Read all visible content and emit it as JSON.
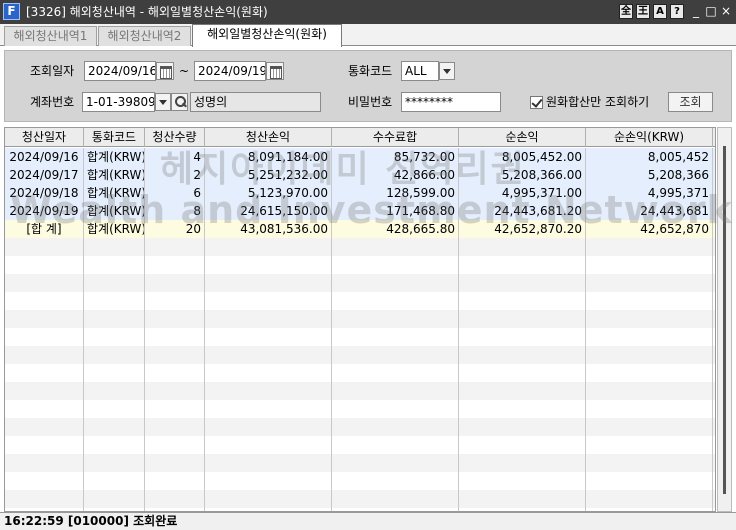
{
  "window": {
    "title": "[3326] 해외청산내역 - 해외일별청산손익(원화)",
    "app_icon": "F",
    "title_buttons": [
      "全",
      "王",
      "A",
      "?"
    ],
    "win_controls": [
      "_",
      "□",
      "×"
    ]
  },
  "tabs": [
    {
      "label": "해외청산내역1",
      "active": false
    },
    {
      "label": "해외청산내역2",
      "active": false
    },
    {
      "label": "해외일별청산손익(원화)",
      "active": true
    }
  ],
  "search": {
    "date_label": "조회일자",
    "date_from": "2024/09/16",
    "date_sep": "~",
    "date_to": "2024/09/19",
    "currency_label": "통화코드",
    "currency_value": "ALL",
    "account_label": "계좌번호",
    "account_value": "1-01-39809",
    "account_name": "성명의",
    "password_label": "비밀번호",
    "password_value": "********",
    "checkbox_label": "원화합산만 조회하기",
    "checkbox_checked": true,
    "search_button": "조회"
  },
  "grid": {
    "columns": [
      "청산일자",
      "통화코드",
      "청산수량",
      "청산손익",
      "수수료합",
      "순손익",
      "순손익(KRW)"
    ],
    "rows": [
      [
        "2024/09/16",
        "합계(KRW)",
        "4",
        "8,091,184.00",
        "85,732.00",
        "8,005,452.00",
        "8,005,452"
      ],
      [
        "2024/09/17",
        "합계(KRW)",
        "2",
        "5,251,232.00",
        "42,866.00",
        "5,208,366.00",
        "5,208,366"
      ],
      [
        "2024/09/18",
        "합계(KRW)",
        "6",
        "5,123,970.00",
        "128,599.00",
        "4,995,371.00",
        "4,995,371"
      ],
      [
        "2024/09/19",
        "합계(KRW)",
        "8",
        "24,615,150.00",
        "171,468.80",
        "24,443,681.20",
        "24,443,681"
      ]
    ],
    "sum_row": [
      "[합 계]",
      "합계(KRW)",
      "20",
      "43,081,536.00",
      "428,665.80",
      "42,652,870.20",
      "42,652,870"
    ]
  },
  "watermark": {
    "line1": "헤지아이데미 선역리권",
    "line2": "Wealth and Investment Network"
  },
  "status": {
    "text": "16:22:59  [010000]  조회완료"
  }
}
